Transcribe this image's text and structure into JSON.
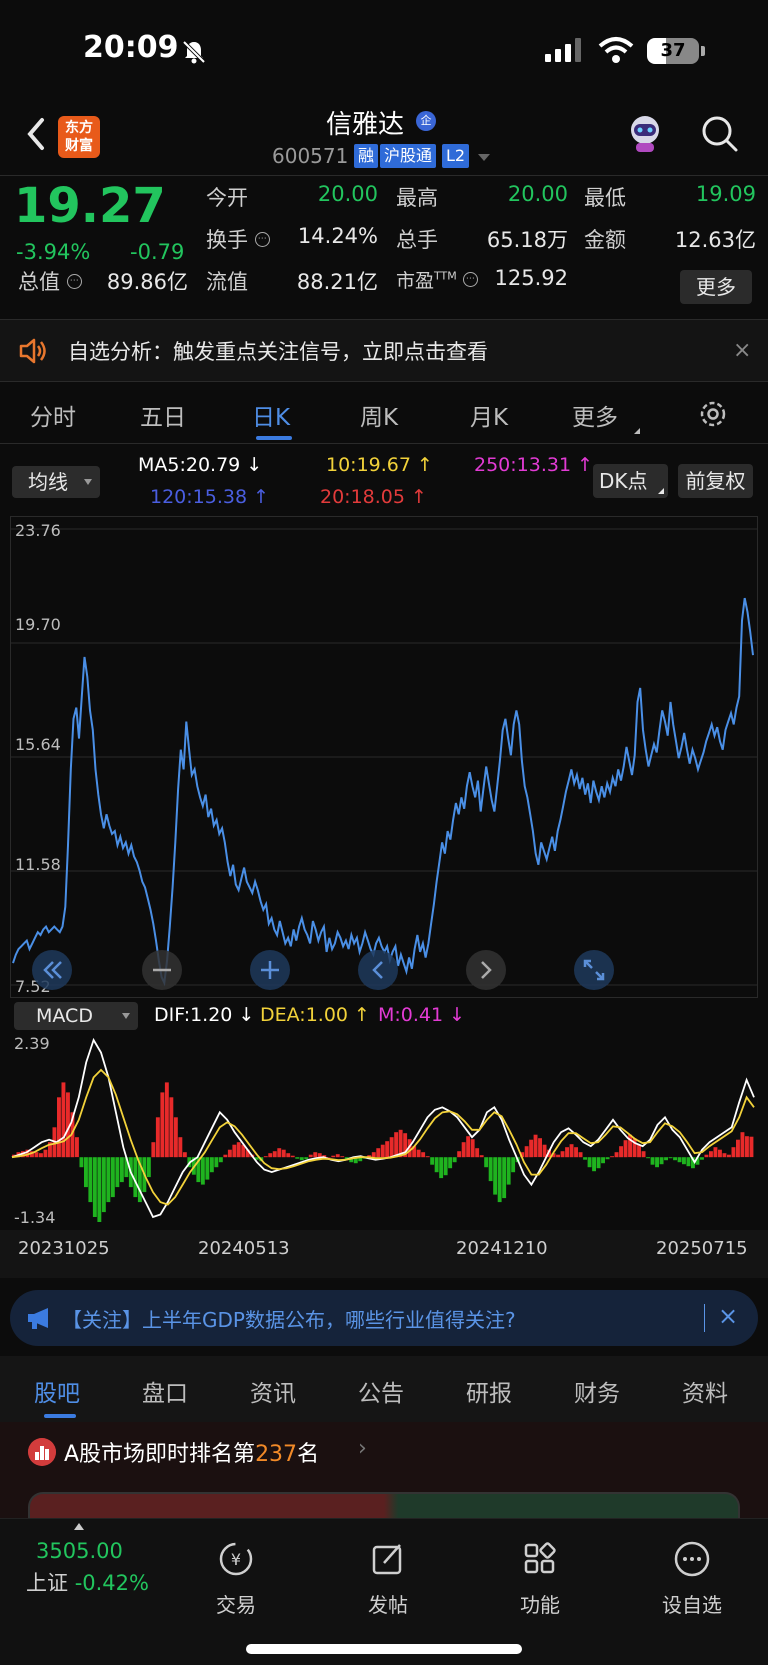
{
  "status_bar": {
    "time": "20:09",
    "battery": "37",
    "battery_level": 0.37
  },
  "header": {
    "stock_name": "信雅达",
    "name_badge": "企",
    "stock_code": "600571",
    "logo_line1": "东方",
    "logo_line2": "财富",
    "tags": [
      "融",
      "沪股通",
      "L2"
    ]
  },
  "quote": {
    "price": "19.27",
    "change_pct": "-3.94%",
    "change_abs": "-0.79",
    "stats": [
      {
        "label": "今开",
        "value": "20.00",
        "color": "green"
      },
      {
        "label": "最高",
        "value": "20.00",
        "color": "green"
      },
      {
        "label": "最低",
        "value": "19.09",
        "color": "green"
      },
      {
        "label": "换手",
        "value": "14.24%",
        "color": "white"
      },
      {
        "label": "总手",
        "value": "65.18万",
        "color": "white"
      },
      {
        "label": "金额",
        "value": "12.63亿",
        "color": "white"
      },
      {
        "label": "总值",
        "value": "89.86亿",
        "color": "white"
      },
      {
        "label": "流值",
        "value": "88.21亿",
        "color": "white"
      },
      {
        "label": "市盈",
        "label_sup": "TTM",
        "value": "125.92",
        "color": "white"
      }
    ],
    "more_label": "更多"
  },
  "alert": {
    "text": "自选分析：触发重点关注信号，立即点击查看",
    "close": "×"
  },
  "chart_tabs": {
    "items": [
      "分时",
      "五日",
      "日K",
      "周K",
      "月K",
      "更多"
    ],
    "active": "日K"
  },
  "indicators": {
    "ma_selector": "均线",
    "ma5": "MA5:20.79",
    "ma10": "10:19.67",
    "ma250": "250:13.31",
    "ma120": "120:15.38",
    "ma20": "20:18.05",
    "dk_button": "DK点",
    "fuquan_button": "前复权",
    "macd_selector": "MACD",
    "dif": "DIF:1.20",
    "dea": "DEA:1.00",
    "m": "M:0.41",
    "colors": {
      "ma5": "#ffffff",
      "ma10": "#f2d23a",
      "ma250": "#e23bd4",
      "ma120": "#4a5ee0",
      "ma20": "#e23b3b"
    }
  },
  "chart_data": [
    {
      "type": "line",
      "title": "",
      "y_ticks": [
        "23.76",
        "19.70",
        "15.64",
        "11.58",
        "7.52"
      ],
      "ylim": [
        7.52,
        23.76
      ],
      "x_ticks": [
        "20231025",
        "20240513",
        "20241210",
        "20250715"
      ],
      "series": [
        {
          "values": [
            8.3,
            8.6,
            8.8,
            8.9,
            9.0,
            9.1,
            8.8,
            9.0,
            9.2,
            9.4,
            9.3,
            9.5,
            9.6,
            9.4,
            9.5,
            9.6,
            9.5,
            9.4,
            9.6,
            10.3,
            12.5,
            15.2,
            17.0,
            17.4,
            16.3,
            17.8,
            19.2,
            18.5,
            17.3,
            16.6,
            15.2,
            14.3,
            13.6,
            13.1,
            13.6,
            13.2,
            12.9,
            13.0,
            12.5,
            12.8,
            12.4,
            12.6,
            12.2,
            12.5,
            12.1,
            11.9,
            11.6,
            11.2,
            11.0,
            10.6,
            10.2,
            9.7,
            9.1,
            8.4,
            7.8,
            7.6,
            8.4,
            9.6,
            11.0,
            12.6,
            14.5,
            15.9,
            15.2,
            16.9,
            15.9,
            15.0,
            15.2,
            14.6,
            14.2,
            13.9,
            14.3,
            13.5,
            13.8,
            13.2,
            13.4,
            12.9,
            13.1,
            12.6,
            11.9,
            11.4,
            11.8,
            11.1,
            10.9,
            11.3,
            11.7,
            11.2,
            11.0,
            10.8,
            11.2,
            10.9,
            10.5,
            10.2,
            10.4,
            9.7,
            9.9,
            9.5,
            9.3,
            9.8,
            9.4,
            9.0,
            9.2,
            8.9,
            9.5,
            9.1,
            9.6,
            9.9,
            9.5,
            9.3,
            9.0,
            9.8,
            9.5,
            9.1,
            9.4,
            9.6,
            8.7,
            9.2,
            8.8,
            9.0,
            9.4,
            9.2,
            8.9,
            9.1,
            8.8,
            9.3,
            9.0,
            9.2,
            8.7,
            9.0,
            9.4,
            9.1,
            8.8,
            8.6,
            9.0,
            9.2,
            8.9,
            8.7,
            8.9,
            8.4,
            8.7,
            8.9,
            8.2,
            8.6,
            8.3,
            8.0,
            8.5,
            8.1,
            8.8,
            9.3,
            8.7,
            9.0,
            8.5,
            9.0,
            9.7,
            10.4,
            11.2,
            11.9,
            12.6,
            12.2,
            13.0,
            12.7,
            13.4,
            14.0,
            13.6,
            14.2,
            13.8,
            14.6,
            15.1,
            14.6,
            14.2,
            14.8,
            13.7,
            14.5,
            15.3,
            14.7,
            14.1,
            13.7,
            14.6,
            15.5,
            16.6,
            17.0,
            16.3,
            15.7,
            16.8,
            17.3,
            16.8,
            15.5,
            14.6,
            14.2,
            13.6,
            13.0,
            12.2,
            11.8,
            12.6,
            12.3,
            12.0,
            12.4,
            12.8,
            12.3,
            13.0,
            13.4,
            13.9,
            14.4,
            14.8,
            15.2,
            14.7,
            15.0,
            14.5,
            14.9,
            14.3,
            14.7,
            14.0,
            14.8,
            14.4,
            14.1,
            14.6,
            14.2,
            14.7,
            14.4,
            14.9,
            14.6,
            15.2,
            14.8,
            15.3,
            16.0,
            15.5,
            15.0,
            15.7,
            17.6,
            18.1,
            16.6,
            15.9,
            15.3,
            15.7,
            16.1,
            15.8,
            16.6,
            17.3,
            16.9,
            16.4,
            17.6,
            16.8,
            16.2,
            15.6,
            16.0,
            16.5,
            15.9,
            15.4,
            15.9,
            15.6,
            15.2,
            15.5,
            15.8,
            16.2,
            16.5,
            16.8,
            16.4,
            16.7,
            16.2,
            15.9,
            16.6,
            16.9,
            17.2,
            16.8,
            17.4,
            17.8,
            20.5,
            21.3,
            20.8,
            20.1,
            19.27
          ]
        }
      ]
    },
    {
      "type": "bar",
      "title": "",
      "y_ticks": [
        "2.39",
        "-1.34"
      ],
      "ylim": [
        -1.34,
        2.39
      ],
      "x_ticks": [
        "20231025",
        "20240513",
        "20241210",
        "20250715"
      ],
      "series": [
        {
          "name": "M",
          "values": [
            0.05,
            0.1,
            0.12,
            0.15,
            0.12,
            0.1,
            0.08,
            0.15,
            0.3,
            0.6,
            1.2,
            1.5,
            1.3,
            0.9,
            0.4,
            -0.2,
            -0.6,
            -0.9,
            -1.2,
            -1.3,
            -1.1,
            -0.9,
            -0.8,
            -0.6,
            -0.5,
            -0.4,
            -0.6,
            -0.8,
            -0.9,
            -0.7,
            -0.4,
            0.3,
            0.8,
            1.3,
            1.5,
            1.2,
            0.8,
            0.4,
            0.1,
            -0.2,
            -0.35,
            -0.5,
            -0.55,
            -0.45,
            -0.3,
            -0.2,
            -0.1,
            0.05,
            0.15,
            0.25,
            0.3,
            0.25,
            0.15,
            0.05,
            -0.05,
            -0.08,
            0.02,
            0.08,
            0.12,
            0.18,
            0.15,
            0.08,
            0.03,
            -0.03,
            -0.06,
            -0.04,
            0.05,
            0.1,
            0.08,
            0.04,
            0.0,
            0.03,
            0.06,
            0.02,
            -0.05,
            -0.1,
            -0.12,
            -0.08,
            -0.03,
            0.04,
            0.1,
            0.18,
            0.25,
            0.32,
            0.4,
            0.5,
            0.55,
            0.48,
            0.36,
            0.22,
            0.15,
            0.1,
            0.02,
            -0.15,
            -0.3,
            -0.42,
            -0.36,
            -0.22,
            -0.1,
            0.12,
            0.3,
            0.42,
            0.36,
            0.18,
            0.04,
            -0.2,
            -0.48,
            -0.75,
            -0.9,
            -0.82,
            -0.55,
            -0.3,
            -0.1,
            0.1,
            0.22,
            0.35,
            0.45,
            0.38,
            0.25,
            0.15,
            0.08,
            0.05,
            0.12,
            0.2,
            0.26,
            0.2,
            0.1,
            -0.05,
            -0.2,
            -0.28,
            -0.22,
            -0.12,
            -0.04,
            0.02,
            0.1,
            0.22,
            0.34,
            0.45,
            0.38,
            0.25,
            0.12,
            -0.02,
            -0.15,
            -0.2,
            -0.14,
            -0.06,
            -0.02,
            -0.06,
            -0.1,
            -0.14,
            -0.18,
            -0.22,
            -0.15,
            -0.05,
            0.05,
            0.12,
            0.2,
            0.15,
            0.08,
            0.05,
            0.2,
            0.35,
            0.5,
            0.42,
            0.41
          ]
        },
        {
          "name": "DIF",
          "values": [
            0.0,
            0.05,
            0.1,
            0.2,
            0.3,
            0.35,
            0.3,
            0.4,
            0.7,
            1.2,
            1.9,
            2.35,
            2.1,
            1.6,
            0.9,
            0.2,
            -0.3,
            -0.6,
            -0.9,
            -1.2,
            -1.15,
            -0.9,
            -0.6,
            -0.3,
            -0.1,
            0.0,
            0.3,
            0.6,
            0.9,
            0.75,
            0.5,
            0.3,
            0.1,
            -0.1,
            -0.25,
            -0.3,
            -0.25,
            -0.2,
            -0.15,
            -0.1,
            -0.05,
            -0.02,
            0.0,
            -0.05,
            -0.08,
            -0.05,
            0.0,
            0.02,
            -0.02,
            -0.05,
            -0.03,
            0.0,
            0.05,
            0.1,
            0.3,
            0.55,
            0.8,
            0.95,
            1.0,
            0.92,
            0.8,
            0.6,
            0.4,
            0.55,
            0.9,
            1.0,
            0.75,
            0.35,
            0.0,
            -0.35,
            -0.55,
            -0.3,
            0.0,
            0.3,
            0.5,
            0.58,
            0.45,
            0.3,
            0.22,
            0.35,
            0.55,
            0.75,
            0.55,
            0.38,
            0.28,
            0.22,
            0.35,
            0.65,
            0.8,
            0.55,
            0.4,
            0.15,
            -0.1,
            0.15,
            0.3,
            0.4,
            0.5,
            0.6,
            1.1,
            1.55,
            1.2
          ]
        },
        {
          "name": "DEA",
          "values": [
            0.0,
            0.02,
            0.05,
            0.1,
            0.18,
            0.25,
            0.28,
            0.32,
            0.45,
            0.75,
            1.2,
            1.6,
            1.75,
            1.6,
            1.25,
            0.8,
            0.35,
            -0.05,
            -0.4,
            -0.7,
            -0.9,
            -0.95,
            -0.8,
            -0.55,
            -0.3,
            -0.1,
            0.1,
            0.35,
            0.6,
            0.7,
            0.62,
            0.45,
            0.25,
            0.05,
            -0.12,
            -0.22,
            -0.24,
            -0.22,
            -0.18,
            -0.13,
            -0.08,
            -0.05,
            -0.03,
            -0.04,
            -0.06,
            -0.05,
            -0.02,
            0.0,
            0.0,
            -0.02,
            -0.02,
            -0.01,
            0.02,
            0.06,
            0.18,
            0.36,
            0.58,
            0.78,
            0.9,
            0.92,
            0.86,
            0.72,
            0.55,
            0.55,
            0.75,
            0.9,
            0.82,
            0.55,
            0.25,
            -0.1,
            -0.35,
            -0.35,
            -0.15,
            0.1,
            0.32,
            0.48,
            0.48,
            0.38,
            0.28,
            0.3,
            0.45,
            0.62,
            0.6,
            0.48,
            0.36,
            0.28,
            0.3,
            0.5,
            0.68,
            0.62,
            0.5,
            0.3,
            0.08,
            0.1,
            0.22,
            0.32,
            0.42,
            0.52,
            0.8,
            1.2,
            1.0
          ]
        }
      ]
    }
  ],
  "news": {
    "text": "【关注】上半年GDP数据公布，哪些行业值得关注?",
    "close": "×"
  },
  "bottom_tabs": {
    "items": [
      "股吧",
      "盘口",
      "资讯",
      "公告",
      "研报",
      "财务",
      "资料"
    ],
    "active": "股吧"
  },
  "rank": {
    "prefix": "A股市场即时排名第",
    "number": "237",
    "suffix": "名",
    "arrow": "›"
  },
  "tabbar": {
    "index_value": "3505.00",
    "index_name": "上证",
    "index_change": "-0.42%",
    "items": [
      {
        "label": "交易",
        "icon": "trade-icon"
      },
      {
        "label": "发帖",
        "icon": "post-icon"
      },
      {
        "label": "功能",
        "icon": "function-icon"
      },
      {
        "label": "设自选",
        "icon": "add-watchlist-icon"
      }
    ]
  }
}
